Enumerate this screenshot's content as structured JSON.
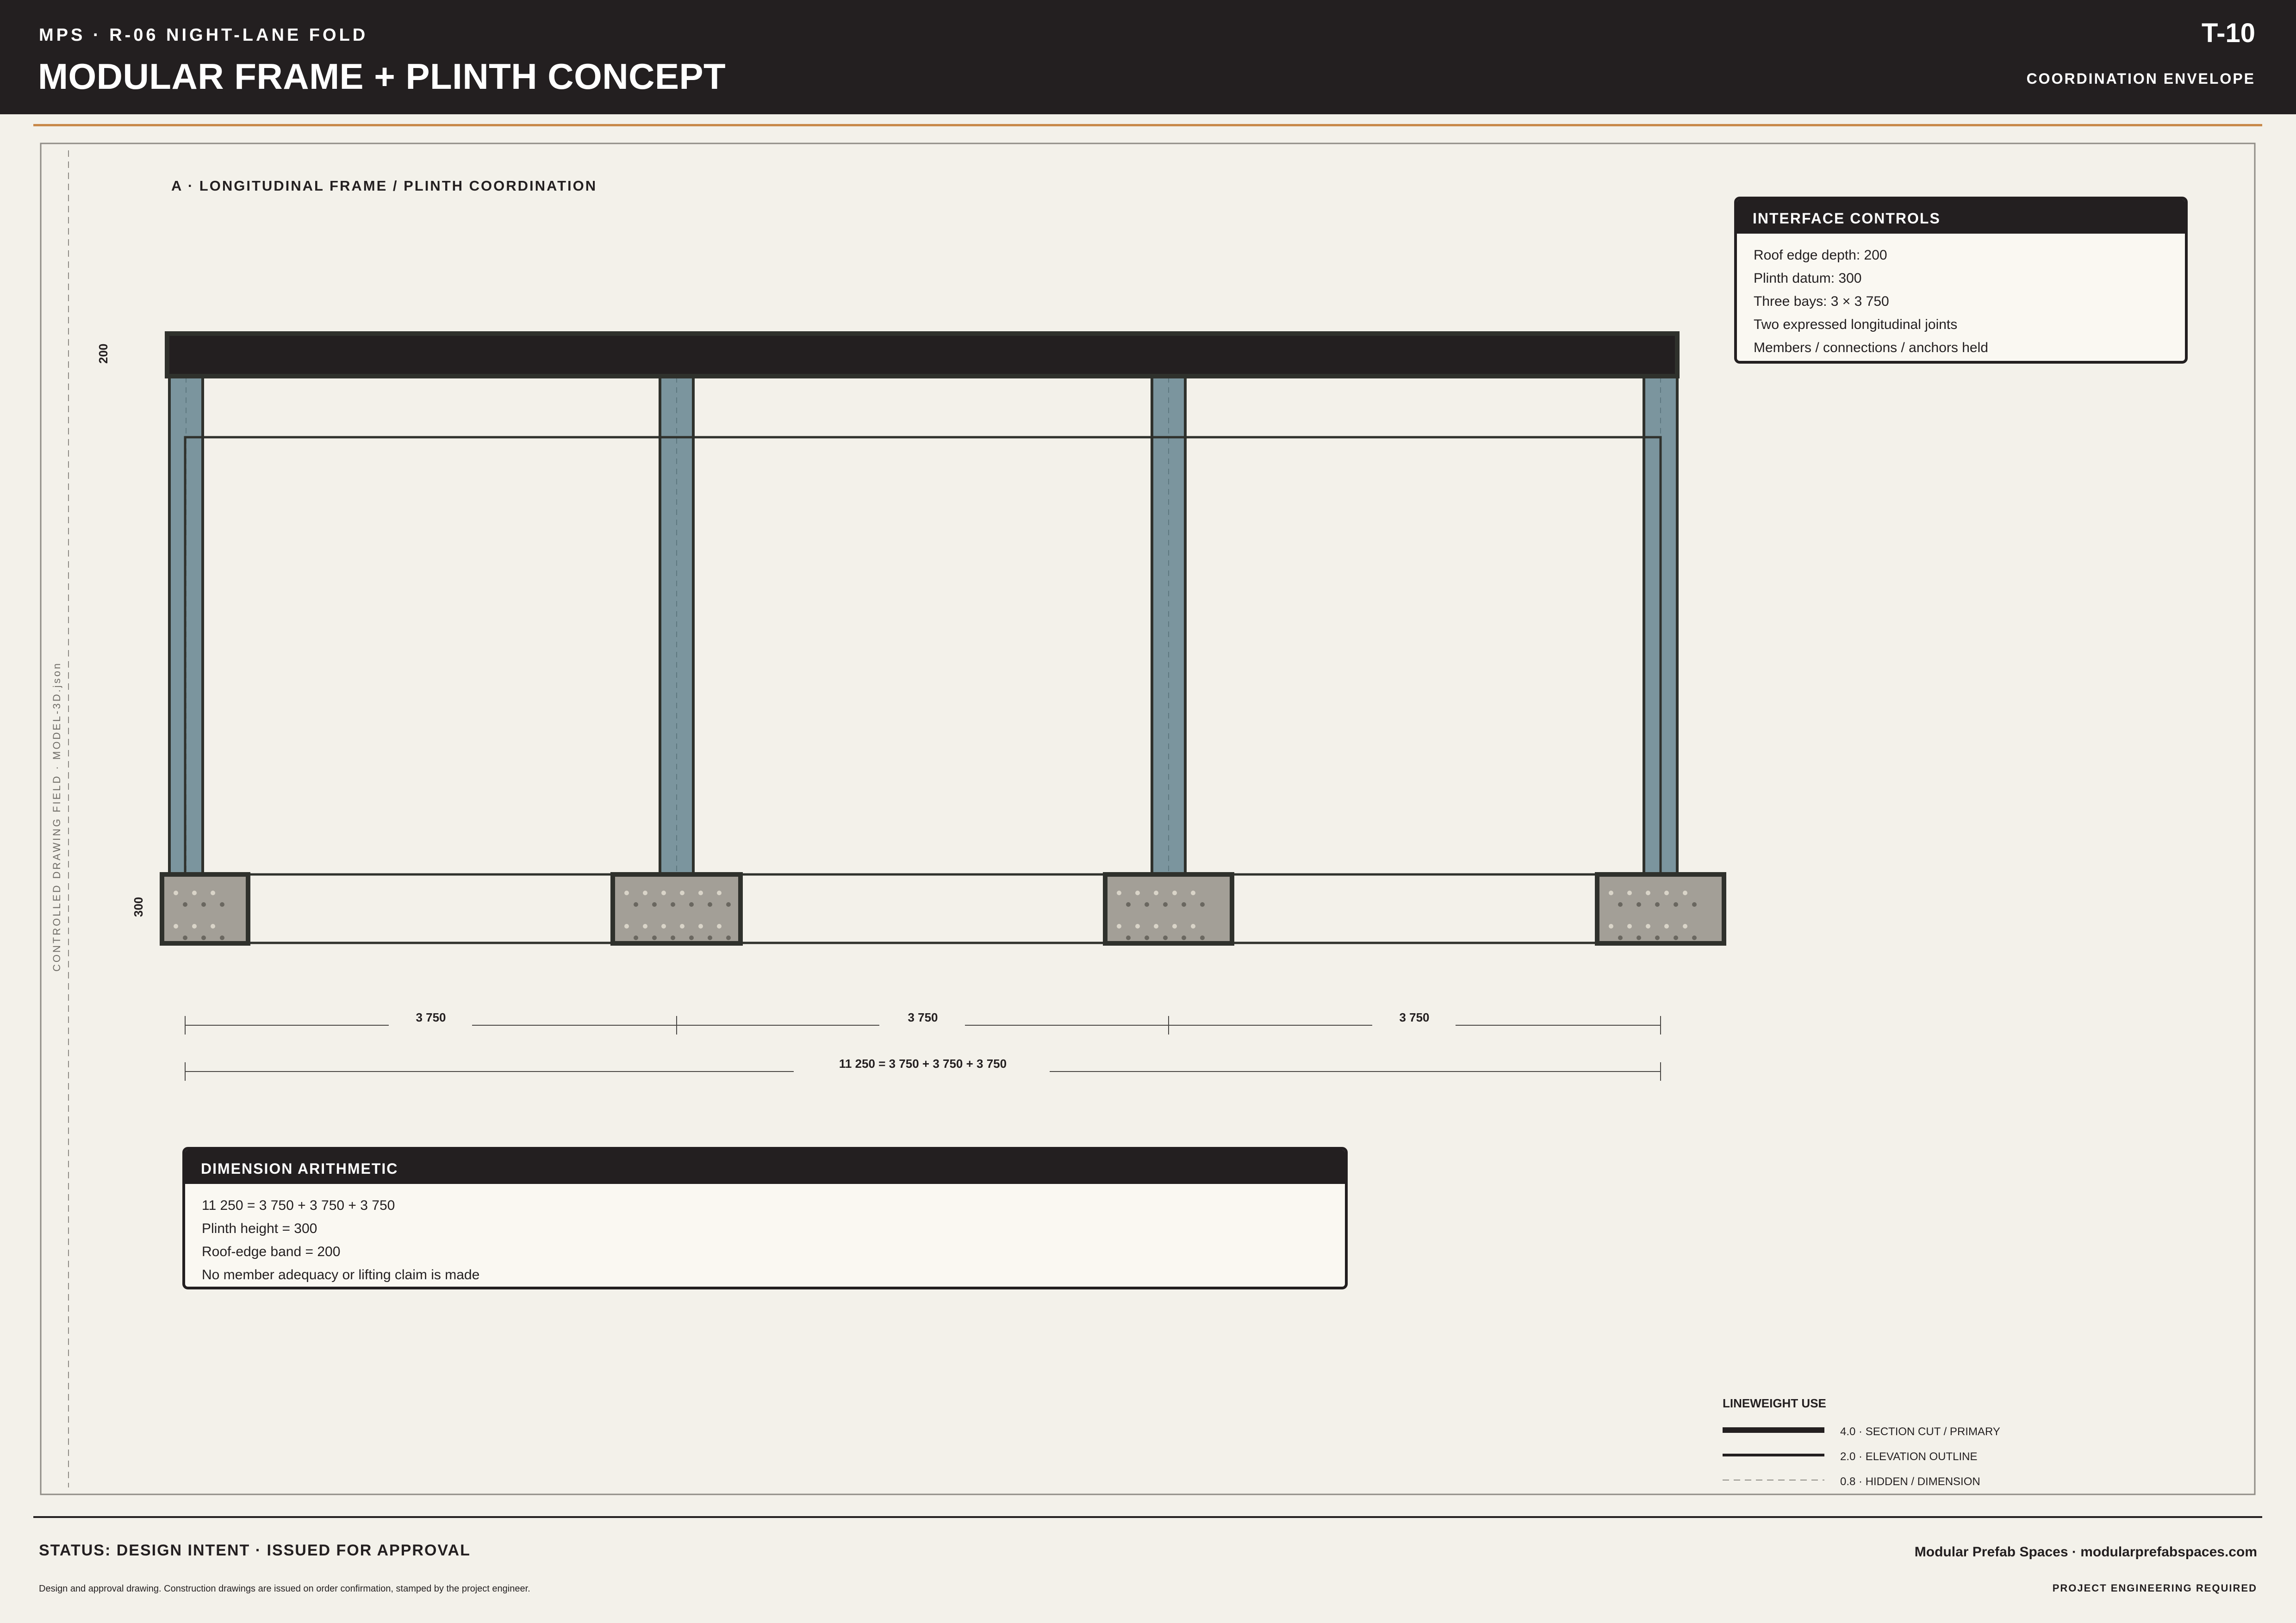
{
  "header": {
    "eyebrow": "MPS · R-06 NIGHT-LANE FOLD",
    "title": "MODULAR FRAME + PLINTH CONCEPT",
    "sheet_number": "T-10",
    "subtitle": "COORDINATION ENVELOPE"
  },
  "margin_label": "CONTROLLED DRAWING FIELD · MODEL-3D.json",
  "drawing": {
    "title": "A · LONGITUDINAL FRAME / PLINTH COORDINATION",
    "roof_edge_dim": "200",
    "plinth_dim": "300",
    "bay_dims": [
      "3 750",
      "3 750",
      "3 750"
    ],
    "overall_dim": "11 250 = 3 750 + 3 750 + 3 750"
  },
  "interface_controls": {
    "title": "INTERFACE CONTROLS",
    "lines": [
      "Roof edge depth: 200",
      "Plinth datum: 300",
      "Three bays: 3 × 3 750",
      "Two expressed longitudinal joints",
      "Members / connections / anchors held"
    ]
  },
  "dimension_arithmetic": {
    "title": "DIMENSION ARITHMETIC",
    "lines": [
      "11 250 = 3 750 + 3 750 + 3 750",
      "Plinth height = 300",
      "Roof-edge band = 200",
      "No member adequacy or lifting claim is made"
    ]
  },
  "lineweight_legend": {
    "title": "LINEWEIGHT USE",
    "items": [
      {
        "label": "4.0 · SECTION CUT / PRIMARY",
        "style": "thick"
      },
      {
        "label": "2.0 · ELEVATION OUTLINE",
        "style": "medium"
      },
      {
        "label": "0.8 · HIDDEN / DIMENSION",
        "style": "dashed"
      }
    ]
  },
  "footer": {
    "status": "STATUS: DESIGN INTENT · ISSUED FOR APPROVAL",
    "note": "Design and approval drawing. Construction drawings are issued on order confirmation, stamped by the project engineer.",
    "company": "Modular Prefab Spaces · modularprefabspaces.com",
    "requirement": "PROJECT ENGINEERING REQUIRED"
  },
  "colors": {
    "sheet_background": "#f3f1ea",
    "header_background": "#231f20",
    "accent": "#c8894a",
    "column_fill": "#7b959e",
    "plinth_fill": "#a39f97",
    "linework": "#2f312c"
  }
}
